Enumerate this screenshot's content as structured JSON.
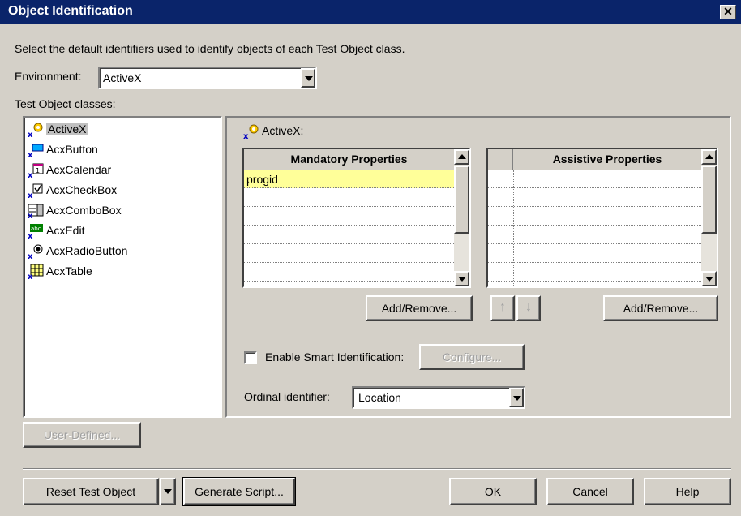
{
  "window": {
    "title": "Object Identification",
    "close_glyph": "✕"
  },
  "instruction": "Select the default identifiers used to identify objects of each Test Object class.",
  "environment": {
    "label": "Environment:",
    "value": "ActiveX"
  },
  "classes": {
    "label": "Test Object classes:",
    "items": [
      {
        "label": "ActiveX",
        "icon": "activex-icon",
        "selected": true
      },
      {
        "label": "AcxButton",
        "icon": "acx-button-icon"
      },
      {
        "label": "AcxCalendar",
        "icon": "acx-calendar-icon"
      },
      {
        "label": "AcxCheckBox",
        "icon": "acx-checkbox-icon"
      },
      {
        "label": "AcxComboBox",
        "icon": "acx-combobox-icon"
      },
      {
        "label": "AcxEdit",
        "icon": "acx-edit-icon"
      },
      {
        "label": "AcxRadioButton",
        "icon": "acx-radiobutton-icon"
      },
      {
        "label": "AcxTable",
        "icon": "acx-table-icon"
      }
    ]
  },
  "details": {
    "class_title": "ActiveX:",
    "mandatory": {
      "header": "Mandatory Properties",
      "rows": [
        "progid",
        "",
        "",
        "",
        "",
        ""
      ]
    },
    "assistive": {
      "header": "Assistive Properties",
      "rows": [
        "",
        "",
        "",
        "",
        "",
        ""
      ]
    },
    "add_remove_label": "Add/Remove...",
    "smart_id_label": "Enable Smart Identification:",
    "configure_label": "Configure...",
    "ordinal_label": "Ordinal identifier:",
    "ordinal_value": "Location"
  },
  "buttons": {
    "user_defined": "User-Defined...",
    "reset": "Reset Test Object",
    "generate_script": "Generate Script...",
    "ok": "OK",
    "cancel": "Cancel",
    "help": "Help"
  },
  "colors": {
    "titlebar": "#0a246a",
    "highlight_row": "#ffff99",
    "face": "#d4d0c8"
  }
}
